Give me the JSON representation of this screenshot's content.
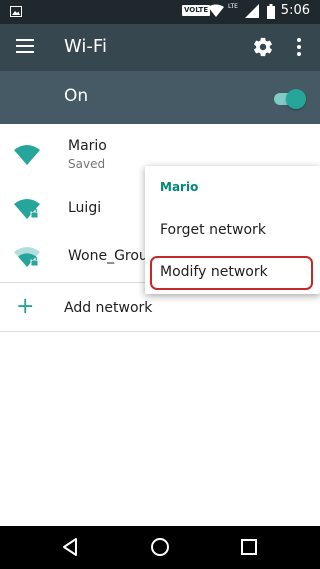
{
  "status_bar": {
    "volte_label": "VOLTE",
    "lte_label": "LTE",
    "time": "5:06",
    "icons": [
      "image-notification-icon",
      "wifi-signal-icon",
      "cell-signal-icon",
      "battery-icon"
    ]
  },
  "toolbar": {
    "title": "Wi-Fi",
    "icons": [
      "menu-icon",
      "gear-icon",
      "overflow-menu-icon"
    ]
  },
  "wifi_switch": {
    "label": "On",
    "state": "on",
    "accent": "#26a69a"
  },
  "networks": [
    {
      "name": "Mario",
      "status": "Saved",
      "secured": false,
      "signal": "full"
    },
    {
      "name": "Luigi",
      "status": "",
      "secured": true,
      "signal": "full"
    },
    {
      "name": "Wone_Group",
      "status": "",
      "secured": true,
      "signal": "medium"
    }
  ],
  "add_network": {
    "label": "Add network",
    "icon": "plus-icon"
  },
  "context_menu": {
    "title": "Mario",
    "items": [
      "Forget network",
      "Modify network"
    ],
    "highlighted_item": "Modify network",
    "highlight_color": "#c62828"
  },
  "nav_bar": {
    "icons": [
      "back-icon",
      "home-icon",
      "recents-icon"
    ]
  },
  "colors": {
    "toolbar": "#37474f",
    "switch_bar": "#455a64",
    "accent": "#26a69a",
    "status_bar": "#1f292d"
  }
}
